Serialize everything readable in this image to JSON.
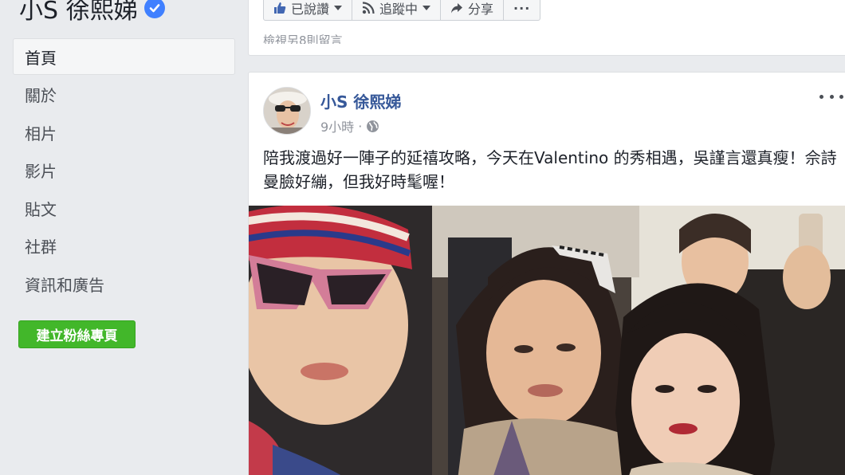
{
  "page": {
    "name": "小S 徐熙娣"
  },
  "sidebar": {
    "items": [
      {
        "label": "首頁"
      },
      {
        "label": "關於"
      },
      {
        "label": "相片"
      },
      {
        "label": "影片"
      },
      {
        "label": "貼文"
      },
      {
        "label": "社群"
      },
      {
        "label": "資訊和廣告"
      }
    ],
    "create_button": "建立粉絲專頁"
  },
  "top_card": {
    "liked_label": "已說讚",
    "following_label": "追蹤中",
    "share_label": "分享",
    "more_label": "···",
    "views_text": "檢視另8則留言"
  },
  "post": {
    "author": "小S 徐熙娣",
    "time": "9小時",
    "dot": "·",
    "text": "陪我渡過好一陣子的延禧攻略，今天在Valentino 的秀相遇，吳謹言還真瘦！佘詩曼臉好繃，但我好時髦喔！"
  },
  "colors": {
    "link": "#365899",
    "green": "#42b72a",
    "background": "#e9ebee",
    "verified": "#4080ff"
  },
  "icons": {
    "like": "thumbs-up-icon",
    "follow": "rss-icon",
    "share": "share-arrow-icon",
    "privacy": "globe-icon",
    "verified": "check-badge-icon"
  }
}
